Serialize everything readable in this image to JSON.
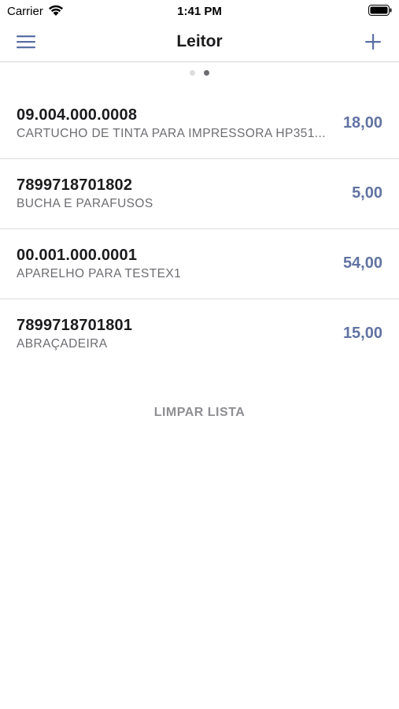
{
  "status_bar": {
    "carrier": "Carrier",
    "time": "1:41 PM",
    "wifi_icon": "wifi-icon",
    "battery_icon": "battery-icon"
  },
  "nav_bar": {
    "title": "Leitor",
    "menu_icon": "hamburger-menu-icon",
    "add_icon": "plus-icon",
    "accent_color": "#5a6fa5"
  },
  "page_indicator": {
    "total": 2,
    "current": 2
  },
  "items": [
    {
      "code": "09.004.000.0008",
      "description": "CARTUCHO DE TINTA PARA IMPRESSORA HP351...",
      "value": "18,00"
    },
    {
      "code": "7899718701802",
      "description": "BUCHA E PARAFUSOS",
      "value": "5,00"
    },
    {
      "code": "00.001.000.0001",
      "description": "APARELHO PARA TESTEX1",
      "value": "54,00"
    },
    {
      "code": "7899718701801",
      "description": "ABRAÇADEIRA",
      "value": "15,00"
    }
  ],
  "clear_button": {
    "label": "LIMPAR LISTA"
  },
  "colors": {
    "value": "#6273a3",
    "secondary_text": "#6d6d72",
    "clear_button": "#8e8e93"
  }
}
